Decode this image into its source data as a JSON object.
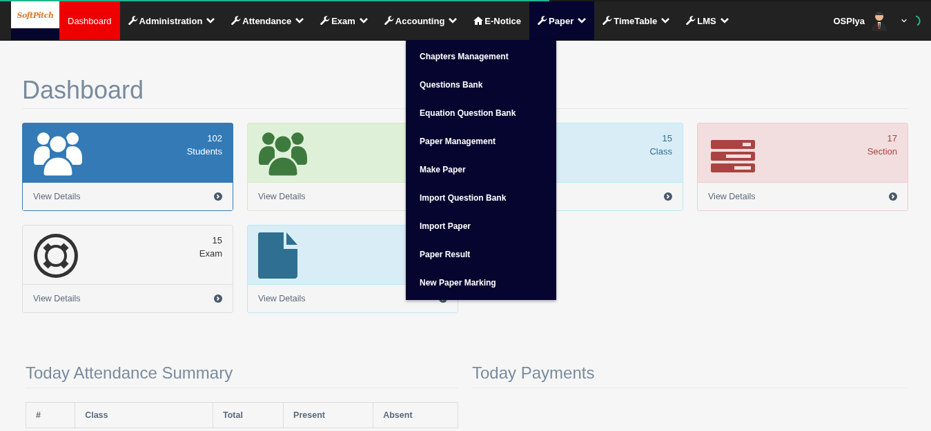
{
  "loading_bar": {
    "level": 0.59
  },
  "navbar": {
    "logo": "SoftPitch",
    "items": [
      {
        "label": "Dashboard",
        "kind": "plain",
        "selected": true,
        "expanded": false
      },
      {
        "label": "Administration",
        "kind": "dropdown",
        "selected": false,
        "expanded": false
      },
      {
        "label": "Attendance",
        "kind": "dropdown",
        "selected": false,
        "expanded": false
      },
      {
        "label": "Exam",
        "kind": "dropdown",
        "selected": false,
        "expanded": false
      },
      {
        "label": "Accounting",
        "kind": "dropdown",
        "selected": false,
        "expanded": false
      },
      {
        "label": "E-Notice",
        "kind": "home",
        "selected": false,
        "expanded": false
      },
      {
        "label": "Paper",
        "kind": "dropdown",
        "selected": false,
        "expanded": true,
        "menu": [
          "Chapters Management",
          "Questions Bank",
          "Equation Question Bank",
          "Paper Management",
          "Make Paper",
          "Import Question Bank",
          "Import Paper",
          "Paper Result",
          "New Paper Marking"
        ]
      },
      {
        "label": "TimeTable",
        "kind": "dropdown",
        "selected": false,
        "expanded": false
      },
      {
        "label": "LMS",
        "kind": "dropdown",
        "selected": false,
        "expanded": false
      }
    ],
    "user": "OSPlya"
  },
  "page_title": "Dashboard",
  "cards": [
    {
      "kind": "primary",
      "count": "102",
      "label": "Students",
      "link": "View Details"
    },
    {
      "kind": "success",
      "link": "View Details"
    },
    {
      "kind": "info",
      "count": "15",
      "label": "Class"
    },
    {
      "kind": "danger",
      "count": "17",
      "label": "Section",
      "link": "View Details"
    },
    {
      "kind": "default",
      "count": "15",
      "label": "Exam",
      "link": "View Details"
    },
    {
      "kind": "info",
      "link": "View Details"
    }
  ],
  "attendance": {
    "title": "Today Attendance Summary",
    "columns": [
      "#",
      "Class",
      "Total",
      "Present",
      "Absent"
    ]
  },
  "payments": {
    "title": "Today Payments"
  }
}
